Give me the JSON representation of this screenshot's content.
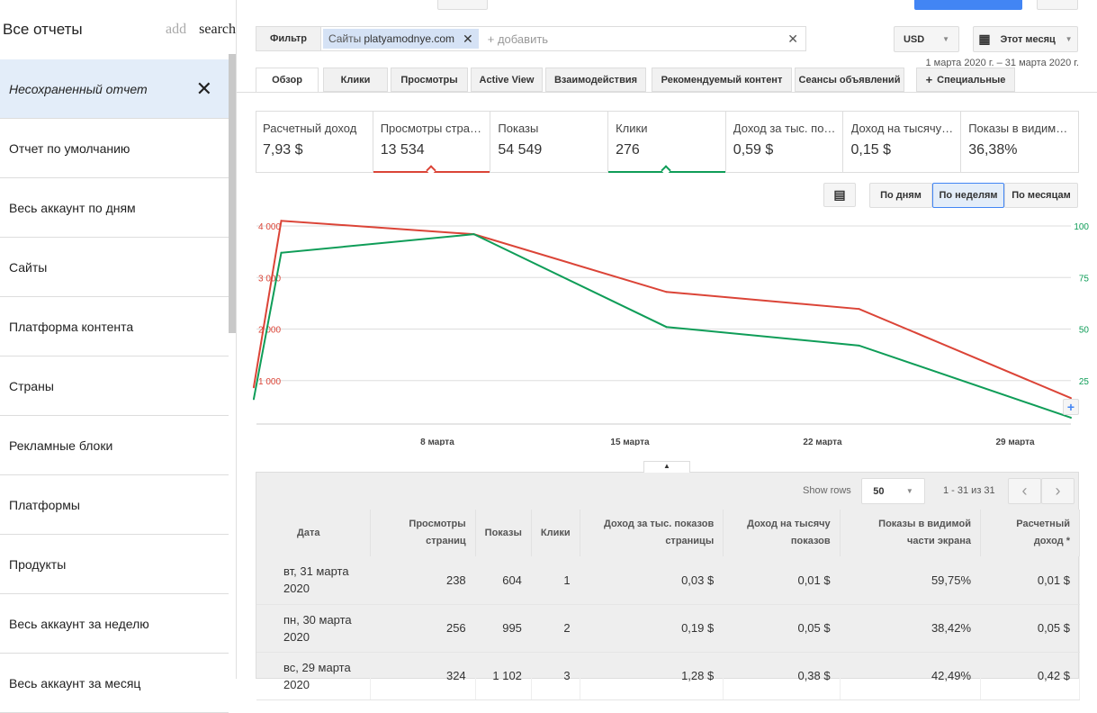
{
  "sidebar": {
    "title": "Все отчеты",
    "add": "add",
    "search": "search",
    "items": [
      {
        "label": "Несохраненный отчет",
        "active": true
      },
      {
        "label": "Отчет по умолчанию"
      },
      {
        "label": "Весь аккаунт по дням"
      },
      {
        "label": "Сайты"
      },
      {
        "label": "Платформа контента"
      },
      {
        "label": "Страны"
      },
      {
        "label": "Рекламные блоки"
      },
      {
        "label": "Платформы"
      },
      {
        "label": "Продукты"
      },
      {
        "label": "Весь аккаунт за неделю"
      },
      {
        "label": "Весь аккаунт за месяц"
      }
    ]
  },
  "filter": {
    "label": "Фильтр",
    "chip_prefix": "Сайты",
    "chip_value": "platyamodnye.com",
    "add_placeholder": "+ добавить"
  },
  "currency": "USD",
  "period": "Этот месяц",
  "date_range": "1 марта 2020 г. – 31 марта 2020 г.",
  "tabs": [
    "Обзор",
    "Клики",
    "Просмотры",
    "Active View",
    "Взаимодействия",
    "Рекомендуемый контент",
    "Сеансы объявлений",
    "Специальные"
  ],
  "metrics": [
    {
      "label": "Расчетный доход",
      "value": "7,93 $"
    },
    {
      "label": "Просмотры страниц",
      "value": "13 534"
    },
    {
      "label": "Показы",
      "value": "54 549"
    },
    {
      "label": "Клики",
      "value": "276"
    },
    {
      "label": "Доход за тыс. показов страницы",
      "value": "0,59 $"
    },
    {
      "label": "Доход на тысячу показов",
      "value": "0,15 $"
    },
    {
      "label": "Показы в видимой части экрана",
      "value": "36,38%"
    }
  ],
  "granularity": [
    "По дням",
    "По неделям",
    "По месяцам"
  ],
  "chart_data": {
    "type": "line",
    "x_ticks": [
      {
        "day": 8,
        "label": "8 марта"
      },
      {
        "day": 15,
        "label": "15 марта"
      },
      {
        "day": 22,
        "label": "22 марта"
      },
      {
        "day": 29,
        "label": "29 марта"
      }
    ],
    "y_left": {
      "ticks": [
        "1 000",
        "2 000",
        "3 000",
        "4 000"
      ],
      "tick_values": [
        1000,
        2000,
        3000,
        4000
      ],
      "range": [
        0,
        4000
      ]
    },
    "y_right": {
      "ticks": [
        "25",
        "50",
        "75",
        "100"
      ],
      "tick_values": [
        25,
        50,
        75,
        100
      ],
      "range": [
        0,
        100
      ]
    },
    "series": [
      {
        "name": "Просмотры страниц",
        "axis": "left",
        "color": "#db4437",
        "x": [
          1,
          2,
          9,
          16,
          23,
          30.7
        ],
        "values": [
          870,
          4100,
          3840,
          2720,
          2390,
          660
        ]
      },
      {
        "name": "Клики",
        "axis": "right",
        "color": "#0f9d58",
        "x": [
          1,
          2,
          9,
          16,
          23,
          30.7
        ],
        "values": [
          16,
          87,
          96,
          51,
          42,
          7
        ]
      }
    ]
  },
  "table": {
    "show_rows_label": "Show rows",
    "rows_per_page": "50",
    "pagination": "1 - 31 из 31",
    "headers": [
      "Дата",
      "Просмотры страниц",
      "Показы",
      "Клики",
      "Доход за тыс. показов страницы",
      "Доход на тысячу показов",
      "Показы в видимой части экрана",
      "Расчетный доход *"
    ],
    "rows": [
      [
        "вт, 31 марта 2020",
        "238",
        "604",
        "1",
        "0,03 $",
        "0,01 $",
        "59,75%",
        "0,01 $"
      ],
      [
        "пн, 30 марта 2020",
        "256",
        "995",
        "2",
        "0,19 $",
        "0,05 $",
        "38,42%",
        "0,05 $"
      ],
      [
        "вс, 29 марта 2020",
        "324",
        "1 102",
        "3",
        "1,28 $",
        "0,38 $",
        "42,49%",
        "0,42 $"
      ]
    ]
  }
}
